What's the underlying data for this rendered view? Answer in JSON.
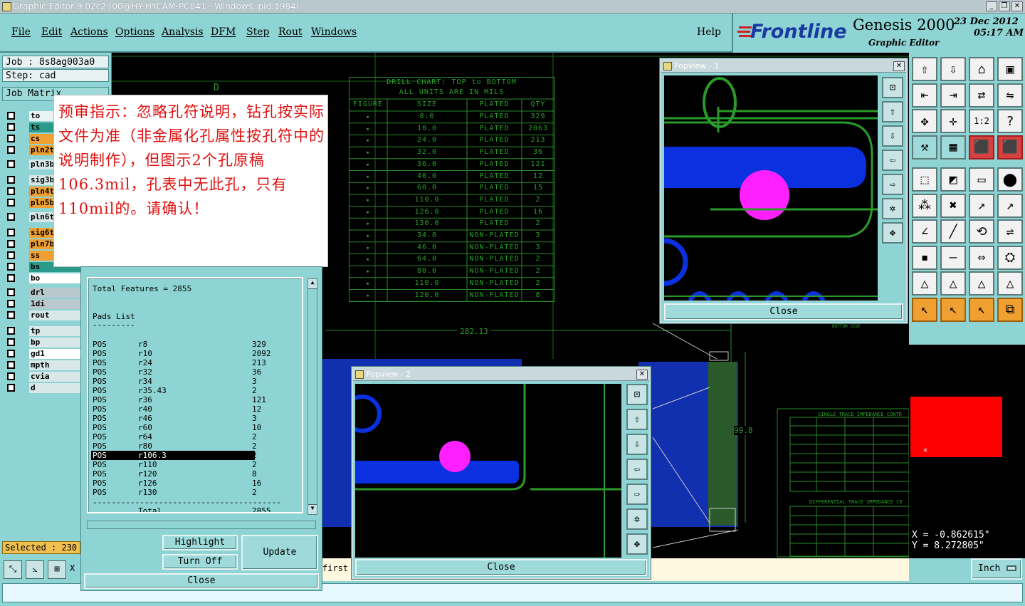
{
  "window": {
    "title": "Graphic Editor 9.02c2 (00@HY-HYCAM-PC041 - Windows, pid:1984)"
  },
  "menu": {
    "items": [
      "File",
      "Edit",
      "Actions",
      "Options",
      "Analysis",
      "DFM",
      "Step",
      "Rout",
      "Windows"
    ],
    "help": "Help"
  },
  "brand": {
    "logo": "Frontline",
    "product": "Genesis 2000",
    "subtitle": "Graphic Editor",
    "date": "23 Dec 2012",
    "time": "05:17 AM"
  },
  "job": {
    "job_label": "Job : 8s8ag003a0",
    "step_label": "Step: cad",
    "matrix_btn": "Job Matrix"
  },
  "layers": [
    {
      "name": "to",
      "color": "#e8f4f4"
    },
    {
      "name": "ts",
      "color": "#2a9a8a"
    },
    {
      "name": "cs",
      "color": "#f0a030"
    },
    {
      "name": "pln2t",
      "color": "#f0a030"
    },
    {
      "name": "pln3b",
      "color": "#d8e8e8"
    },
    {
      "name": "sig3b",
      "color": "#d8e8e8"
    },
    {
      "name": "pln4t",
      "color": "#f0a030"
    },
    {
      "name": "pln5b",
      "color": "#f0a030"
    },
    {
      "name": "pln6t",
      "color": "#d8e8e8"
    },
    {
      "name": "sig6t",
      "color": "#f0a030"
    },
    {
      "name": "pln7b",
      "color": "#f0a030"
    },
    {
      "name": "ss",
      "color": "#f0a030"
    },
    {
      "name": "bs",
      "color": "#2a9a8a"
    },
    {
      "name": "bo",
      "color": "#ffffff"
    },
    {
      "name": "drl",
      "color": "#b8c8cc"
    },
    {
      "name": "1di",
      "color": "#b8c8cc"
    },
    {
      "name": "rout",
      "color": "#d8e8e8"
    },
    {
      "name": "tp",
      "color": "#d8e8e8"
    },
    {
      "name": "bp",
      "color": "#d8e8e8"
    },
    {
      "name": "gd1",
      "color": "#ffffff"
    },
    {
      "name": "mpth",
      "color": "#d8e8e8"
    },
    {
      "name": "cvia",
      "color": "#d8e8e8"
    },
    {
      "name": "d",
      "color": "#d8e8e8"
    }
  ],
  "selected": "Selected : 230",
  "annotation": "预审指示：忽略孔符说明，钻孔按实际文件为准（非金属化孔属性按孔符中的说明制作），但图示2个孔原稿106.3mil，孔表中无此孔，只有110mil的。请确认！",
  "drill_chart": {
    "title1": "DRILL CHART: TOP to BOTTOM",
    "title2": "ALL UNITS ARE IN MILS",
    "headers": [
      "FIGURE",
      "SIZE",
      "PLATED",
      "QTY"
    ],
    "rows": [
      [
        "8.0",
        "PLATED",
        "329"
      ],
      [
        "10.0",
        "PLATED",
        "2063"
      ],
      [
        "24.0",
        "PLATED",
        "213"
      ],
      [
        "32.0",
        "PLATED",
        "36"
      ],
      [
        "36.0",
        "PLATED",
        "121"
      ],
      [
        "40.0",
        "PLATED",
        "12"
      ],
      [
        "60.0",
        "PLATED",
        "15"
      ],
      [
        "110.0",
        "PLATED",
        "2"
      ],
      [
        "126.0",
        "PLATED",
        "16"
      ],
      [
        "130.0",
        "PLATED",
        "2"
      ],
      [
        "34.0",
        "NON-PLATED",
        "3"
      ],
      [
        "46.0",
        "NON-PLATED",
        "3"
      ],
      [
        "64.0",
        "NON-PLATED",
        "2"
      ],
      [
        "80.0",
        "NON-PLATED",
        "2"
      ],
      [
        "110.0",
        "NON-PLATED",
        "2"
      ],
      [
        "120.0",
        "NON-PLATED",
        "8"
      ]
    ]
  },
  "dimensions": {
    "horizontal": "282.13",
    "vertical": "99.8"
  },
  "canvas_labels": {
    "bottom_side": "BOTTOM SIDE",
    "single_imp": "SINGLE TRACE IMPEDANCE CONTR",
    "diff_imp": "DIFFERENTIAL TRACE IMPEDANCE CO",
    "d_letter": "D"
  },
  "features": {
    "total": "Total Features = 2855",
    "pads_title": "Pads List",
    "rows": [
      [
        "POS",
        "r8",
        "329"
      ],
      [
        "POS",
        "r10",
        "2092"
      ],
      [
        "POS",
        "r24",
        "213"
      ],
      [
        "POS",
        "r32",
        "36"
      ],
      [
        "POS",
        "r34",
        "3"
      ],
      [
        "POS",
        "r35.43",
        "2"
      ],
      [
        "POS",
        "r36",
        "121"
      ],
      [
        "POS",
        "r40",
        "12"
      ],
      [
        "POS",
        "r46",
        "3"
      ],
      [
        "POS",
        "r60",
        "10"
      ],
      [
        "POS",
        "r64",
        "2"
      ],
      [
        "POS",
        "r80",
        "2"
      ],
      [
        "POS",
        "r106.3",
        "2"
      ],
      [
        "POS",
        "r110",
        "2"
      ],
      [
        "POS",
        "r120",
        "8"
      ],
      [
        "POS",
        "r126",
        "16"
      ],
      [
        "POS",
        "r130",
        "2"
      ]
    ],
    "total_label": "Total",
    "total_value": "2855",
    "highlight": "Highlight",
    "turn_off": "Turn Off",
    "update": "Update",
    "close": "Close"
  },
  "popview1": {
    "title": "Popview - 1",
    "close": "Close"
  },
  "popview2": {
    "title": "Popview - 2",
    "close": "Close"
  },
  "coords": {
    "x": "X =  -0.862615\"",
    "y": "Y =  8.272805\""
  },
  "units": "Inch",
  "prompt": {
    "first": "first",
    "x": "X"
  }
}
